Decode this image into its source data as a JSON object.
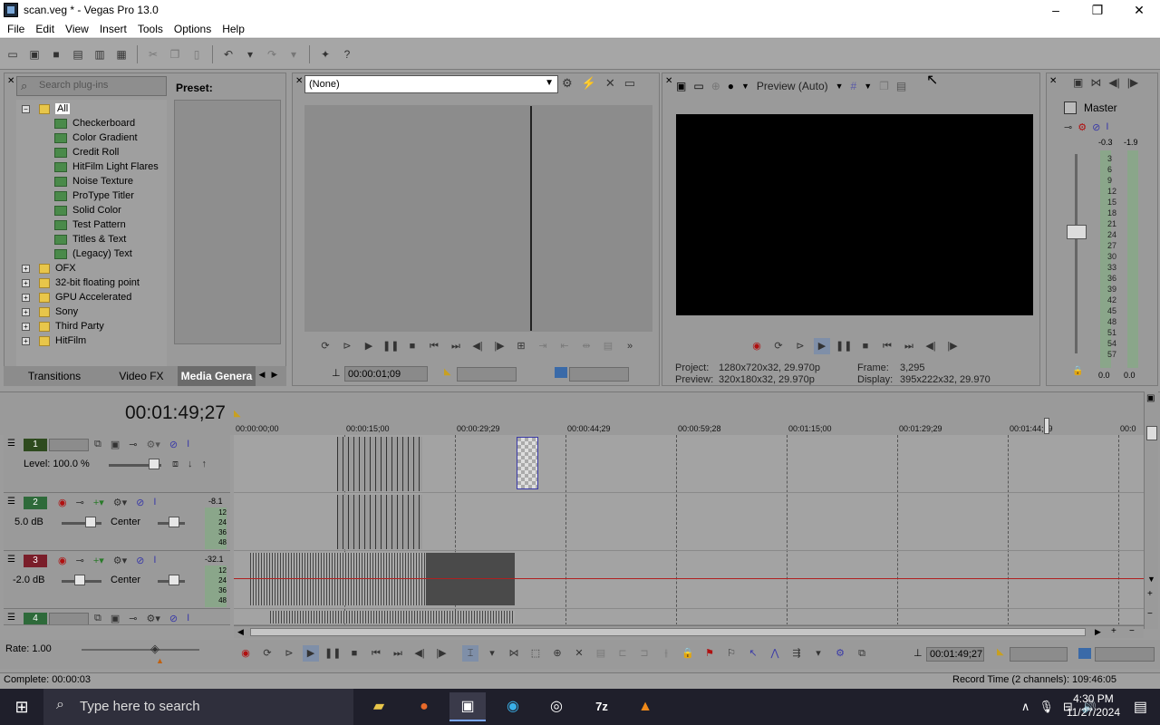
{
  "window": {
    "title": "scan.veg * - Vegas Pro 13.0",
    "minimize": "–",
    "maximize": "❐",
    "close": "✕"
  },
  "menu": [
    "File",
    "Edit",
    "View",
    "Insert",
    "Tools",
    "Options",
    "Help"
  ],
  "explorer": {
    "search_placeholder": "Search plug-ins",
    "preset_label": "Preset:",
    "tree": [
      {
        "label": "All",
        "level": 0,
        "kind": "folder",
        "expander": "−",
        "selected": true
      },
      {
        "label": "Checkerboard",
        "level": 1,
        "kind": "fx"
      },
      {
        "label": "Color Gradient",
        "level": 1,
        "kind": "fx"
      },
      {
        "label": "Credit Roll",
        "level": 1,
        "kind": "fx"
      },
      {
        "label": "HitFilm Light Flares",
        "level": 1,
        "kind": "fx"
      },
      {
        "label": "Noise Texture",
        "level": 1,
        "kind": "fx"
      },
      {
        "label": "ProType Titler",
        "level": 1,
        "kind": "fx"
      },
      {
        "label": "Solid Color",
        "level": 1,
        "kind": "fx"
      },
      {
        "label": "Test Pattern",
        "level": 1,
        "kind": "fx"
      },
      {
        "label": "Titles & Text",
        "level": 1,
        "kind": "fx"
      },
      {
        "label": "(Legacy) Text",
        "level": 1,
        "kind": "fx"
      },
      {
        "label": "OFX",
        "level": 0,
        "kind": "folder",
        "expander": "+"
      },
      {
        "label": "32-bit floating point",
        "level": 0,
        "kind": "folder",
        "expander": "+"
      },
      {
        "label": "GPU Accelerated",
        "level": 0,
        "kind": "folder",
        "expander": "+"
      },
      {
        "label": "Sony",
        "level": 0,
        "kind": "folder",
        "expander": "+"
      },
      {
        "label": "Third Party",
        "level": 0,
        "kind": "folder",
        "expander": "+"
      },
      {
        "label": "HitFilm",
        "level": 0,
        "kind": "folder",
        "expander": "+"
      }
    ],
    "tabs": [
      "Transitions",
      "Video FX",
      "Media Genera"
    ]
  },
  "trimmer": {
    "dropdown_value": "(None)",
    "timecode": "00:00:01;09"
  },
  "preview": {
    "quality": "Preview (Auto)",
    "project_label": "Project:",
    "project_value": "1280x720x32, 29.970p",
    "preview_label": "Preview:",
    "preview_value": "320x180x32, 29.970p",
    "frame_label": "Frame:",
    "frame_value": "3,295",
    "display_label": "Display:",
    "display_value": "395x222x32, 29.970"
  },
  "master": {
    "title": "Master",
    "peak_left": "-0.3",
    "peak_right": "-1.9",
    "scale": [
      "3",
      "6",
      "9",
      "12",
      "15",
      "18",
      "21",
      "24",
      "27",
      "30",
      "33",
      "36",
      "39",
      "42",
      "45",
      "48",
      "51",
      "54",
      "57"
    ],
    "bottom_left": "0.0",
    "bottom_right": "0.0",
    "fader_level": 0.61
  },
  "timeline": {
    "timecode": "00:01:49;27",
    "ruler": [
      "00:00:00;00",
      "00:00:15;00",
      "00:00:29;29",
      "00:00:44;29",
      "00:00:59;28",
      "00:01:15;00",
      "00:01:29;29",
      "00:01:44;29",
      "00:0"
    ],
    "tracks": [
      {
        "number": "1",
        "color": "#2e4a1e",
        "type": "video",
        "level_label": "Level: 100.0 %"
      },
      {
        "number": "2",
        "color": "#2e6a3a",
        "type": "audio",
        "volume": "5.0 dB",
        "pan": "Center",
        "peak": "-8.1"
      },
      {
        "number": "3",
        "color": "#7a1e2a",
        "type": "audio",
        "volume": "-2.0 dB",
        "pan": "Center",
        "peak": "-32.1"
      },
      {
        "number": "4",
        "color": "#2e6a3a",
        "type": "video"
      }
    ],
    "meter_ticks": [
      "12",
      "24",
      "36",
      "48"
    ],
    "rate_label": "Rate: 1.00",
    "bottom_timecode": "00:01:49;27"
  },
  "status": {
    "left": "Complete: 00:00:03",
    "right": "Record Time (2 channels): 109:46:05"
  },
  "taskbar": {
    "search_placeholder": "Type here to search",
    "apps": [
      "file-explorer",
      "firefox",
      "vegas",
      "edge",
      "obs",
      "7zip",
      "vlc"
    ],
    "time": "4:30 PM",
    "date": "11/27/2024"
  }
}
